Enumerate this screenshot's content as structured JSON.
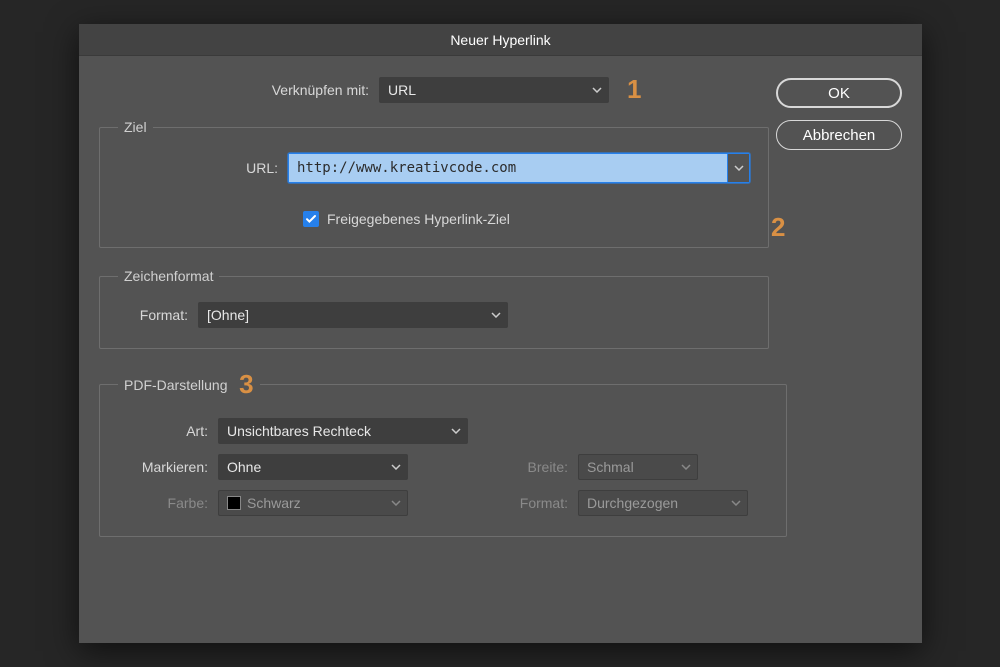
{
  "title": "Neuer Hyperlink",
  "buttons": {
    "ok": "OK",
    "cancel": "Abbrechen"
  },
  "linkTo": {
    "label": "Verknüpfen mit:",
    "value": "URL"
  },
  "target": {
    "legend": "Ziel",
    "url_label": "URL:",
    "url_value": "http://www.kreativcode.com",
    "shared_label": "Freigegebenes Hyperlink-Ziel"
  },
  "charFmt": {
    "legend": "Zeichenformat",
    "label": "Format:",
    "value": "[Ohne]"
  },
  "pdf": {
    "legend": "PDF-Darstellung",
    "type_label": "Art:",
    "type_value": "Unsichtbares Rechteck",
    "highlight_label": "Markieren:",
    "highlight_value": "Ohne",
    "width_label": "Breite:",
    "width_value": "Schmal",
    "color_label": "Farbe:",
    "color_value": "Schwarz",
    "style_label": "Format:",
    "style_value": "Durchgezogen"
  },
  "annotations": {
    "a1": "1",
    "a2": "2",
    "a3": "3"
  }
}
